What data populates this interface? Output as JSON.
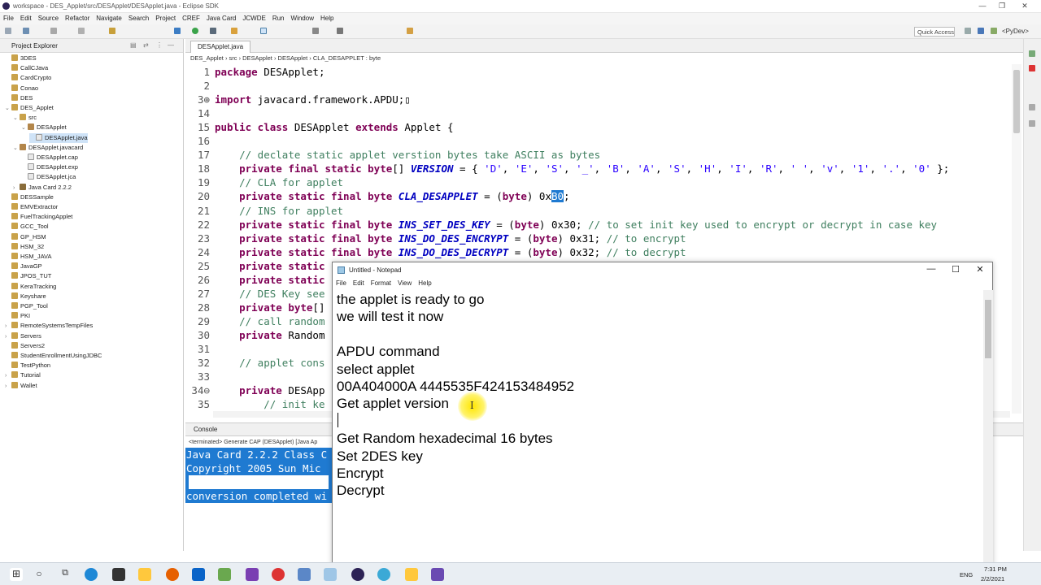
{
  "window": {
    "title": "workspace - DES_Applet/src/DESApplet/DESApplet.java - Eclipse SDK",
    "minimize_glyph": "—",
    "maximize_glyph": "❐",
    "close_glyph": "✕"
  },
  "menu": [
    "File",
    "Edit",
    "Source",
    "Refactor",
    "Navigate",
    "Search",
    "Project",
    "CREF",
    "Java Card",
    "JCWDE",
    "Run",
    "Window",
    "Help"
  ],
  "toolbar": {
    "quick_access": "Quick Access",
    "perspective": "<PyDev>"
  },
  "explorer": {
    "title": "Project Explorer",
    "items": [
      {
        "label": "3DES",
        "indent": 0,
        "icon": "folder",
        "arrow": ""
      },
      {
        "label": "CallCJava",
        "indent": 0,
        "icon": "folder",
        "arrow": ""
      },
      {
        "label": "CardCrypto",
        "indent": 0,
        "icon": "folder",
        "arrow": ""
      },
      {
        "label": "Conao",
        "indent": 0,
        "icon": "folder",
        "arrow": ""
      },
      {
        "label": "DES",
        "indent": 0,
        "icon": "folder",
        "arrow": ""
      },
      {
        "label": "DES_Applet",
        "indent": 0,
        "icon": "folder",
        "arrow": "⌄"
      },
      {
        "label": "src",
        "indent": 1,
        "icon": "folder",
        "arrow": "⌄"
      },
      {
        "label": "DESApplet",
        "indent": 2,
        "icon": "pkg",
        "arrow": "⌄"
      },
      {
        "label": "DESApplet.java",
        "indent": 3,
        "icon": "file",
        "arrow": "",
        "selected": true
      },
      {
        "label": "DESApplet.javacard",
        "indent": 1,
        "icon": "pkg",
        "arrow": "⌄"
      },
      {
        "label": "DESApplet.cap",
        "indent": 2,
        "icon": "file",
        "arrow": ""
      },
      {
        "label": "DESApplet.exp",
        "indent": 2,
        "icon": "file",
        "arrow": ""
      },
      {
        "label": "DESApplet.jca",
        "indent": 2,
        "icon": "file",
        "arrow": ""
      },
      {
        "label": "Java Card 2.2.2",
        "indent": 1,
        "icon": "jar",
        "arrow": "›"
      },
      {
        "label": "DESSample",
        "indent": 0,
        "icon": "folder",
        "arrow": ""
      },
      {
        "label": "EMVExtractor",
        "indent": 0,
        "icon": "folder",
        "arrow": ""
      },
      {
        "label": "FuelTrackingApplet",
        "indent": 0,
        "icon": "folder",
        "arrow": ""
      },
      {
        "label": "GCC_Tool",
        "indent": 0,
        "icon": "folder",
        "arrow": ""
      },
      {
        "label": "GP_HSM",
        "indent": 0,
        "icon": "folder",
        "arrow": ""
      },
      {
        "label": "HSM_32",
        "indent": 0,
        "icon": "folder",
        "arrow": ""
      },
      {
        "label": "HSM_JAVA",
        "indent": 0,
        "icon": "folder",
        "arrow": ""
      },
      {
        "label": "JavaGP",
        "indent": 0,
        "icon": "folder",
        "arrow": ""
      },
      {
        "label": "JPOS_TUT",
        "indent": 0,
        "icon": "folder",
        "arrow": ""
      },
      {
        "label": "KeraTracking",
        "indent": 0,
        "icon": "folder",
        "arrow": ""
      },
      {
        "label": "Keyshare",
        "indent": 0,
        "icon": "folder",
        "arrow": ""
      },
      {
        "label": "PGP_Tool",
        "indent": 0,
        "icon": "folder",
        "arrow": ""
      },
      {
        "label": "PKI",
        "indent": 0,
        "icon": "folder",
        "arrow": ""
      },
      {
        "label": "RemoteSystemsTempFiles",
        "indent": 0,
        "icon": "folder",
        "arrow": "›"
      },
      {
        "label": "Servers",
        "indent": 0,
        "icon": "folder",
        "arrow": "›"
      },
      {
        "label": "Servers2",
        "indent": 0,
        "icon": "folder",
        "arrow": ""
      },
      {
        "label": "StudentEnrollmentUsingJDBC",
        "indent": 0,
        "icon": "folder",
        "arrow": ""
      },
      {
        "label": "TestPython",
        "indent": 0,
        "icon": "folder",
        "arrow": ""
      },
      {
        "label": "Tutorial",
        "indent": 0,
        "icon": "folder",
        "arrow": "›"
      },
      {
        "label": "Wallet",
        "indent": 0,
        "icon": "folder",
        "arrow": "›"
      }
    ]
  },
  "editor": {
    "tab": "DESApplet.java",
    "breadcrumb": "DES_Applet  ›  src  ›  DESApplet  ›  DESApplet  ›  CLA_DESAPPLET : byte",
    "lines": [
      {
        "n": "1",
        "html": "<span class='kw'>package</span> DESApplet;"
      },
      {
        "n": "2",
        "html": ""
      },
      {
        "n": "3⊕",
        "html": "<span class='kw'>import</span> javacard.framework.APDU;▯"
      },
      {
        "n": "14",
        "html": ""
      },
      {
        "n": "15",
        "html": "<span class='kw'>public class</span> DESApplet <span class='kw'>extends</span> Applet {"
      },
      {
        "n": "16",
        "html": ""
      },
      {
        "n": "17",
        "html": "    <span class='cm'>// declate static applet verstion bytes take ASCII as bytes</span>"
      },
      {
        "n": "18",
        "html": "    <span class='kw'>private final static byte</span>[] <span class='fi'>VERSION</span> = { <span class='st'>'D'</span>, <span class='st'>'E'</span>, <span class='st'>'S'</span>, <span class='st'>'_'</span>, <span class='st'>'B'</span>, <span class='st'>'A'</span>, <span class='st'>'S'</span>, <span class='st'>'H'</span>, <span class='st'>'I'</span>, <span class='st'>'R'</span>, <span class='st'>' '</span>, <span class='st'>'v'</span>, <span class='st'>'1'</span>, <span class='st'>'.'</span>, <span class='st'>'0'</span> };"
      },
      {
        "n": "19",
        "html": "    <span class='cm'>// CLA for applet</span>"
      },
      {
        "n": "20",
        "html": "    <span class='kw'>private static final byte</span> <span class='fi'>CLA_DESAPPLET</span> = (<span class='kw'>byte</span>) 0x<span class='hl'>B0</span>;"
      },
      {
        "n": "21",
        "html": "    <span class='cm'>// INS for applet</span>"
      },
      {
        "n": "22",
        "html": "    <span class='kw'>private static final byte</span> <span class='fi'>INS_SET_DES_KEY</span> = (<span class='kw'>byte</span>) 0x30; <span class='cm'>// to set init key used to encrypt or decrypt in case key</span>"
      },
      {
        "n": "23",
        "html": "    <span class='kw'>private static final byte</span> <span class='fi'>INS_DO_DES_ENCRYPT</span> = (<span class='kw'>byte</span>) 0x31; <span class='cm'>// to encrypt</span>"
      },
      {
        "n": "24",
        "html": "    <span class='kw'>private static final byte</span> <span class='fi'>INS_DO_DES_DECRYPT</span> = (<span class='kw'>byte</span>) 0x32; <span class='cm'>// to decrypt</span>"
      },
      {
        "n": "25",
        "html": "    <span class='kw'>private static</span>"
      },
      {
        "n": "26",
        "html": "    <span class='kw'>private static</span>"
      },
      {
        "n": "27",
        "html": "    <span class='cm'>// DES Key see</span>"
      },
      {
        "n": "28",
        "html": "    <span class='kw'>private byte</span>[]"
      },
      {
        "n": "29",
        "html": "    <span class='cm'>// call random</span>"
      },
      {
        "n": "30",
        "html": "    <span class='kw'>private</span> Random"
      },
      {
        "n": "31",
        "html": ""
      },
      {
        "n": "32",
        "html": "    <span class='cm'>// applet cons</span>"
      },
      {
        "n": "33",
        "html": ""
      },
      {
        "n": "34⊖",
        "html": "    <span class='kw'>private</span> DESApp"
      },
      {
        "n": "35",
        "html": "        <span class='cm'>// init ke</span>"
      }
    ]
  },
  "console": {
    "title": "Console",
    "terminated": "<terminated> Generate CAP (DESApplet) [Java Ap",
    "lines": [
      "Java Card 2.2.2 Class C",
      "Copyright 2005 Sun Mic",
      "",
      "conversion completed wi"
    ]
  },
  "notepad": {
    "title": "Untitled - Notepad",
    "menu": [
      "File",
      "Edit",
      "Format",
      "View",
      "Help"
    ],
    "lines": [
      "the applet is ready to go",
      "we will test it now",
      "",
      "APDU command",
      "select applet",
      "00A404000A 4445535F424153484952",
      "Get applet version",
      "",
      "Get Random hexadecimal 16 bytes",
      "Set 2DES key",
      "Encrypt",
      "Decrypt"
    ]
  },
  "taskbar": {
    "lang": "ENG",
    "time": "7:31 PM",
    "date": "2/2/2021"
  }
}
